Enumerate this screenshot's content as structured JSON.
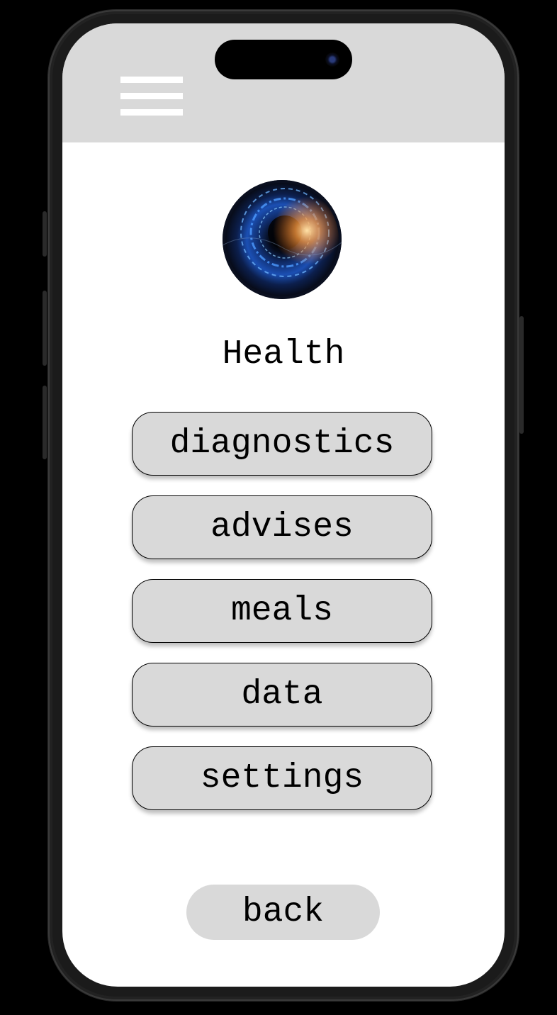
{
  "header": {
    "menu_icon": "hamburger-menu-icon"
  },
  "logo": {
    "icon": "eye-logo-image"
  },
  "page": {
    "title": "Health"
  },
  "menu": {
    "items": [
      {
        "label": "diagnostics"
      },
      {
        "label": "advises"
      },
      {
        "label": "meals"
      },
      {
        "label": "data"
      },
      {
        "label": "settings"
      }
    ]
  },
  "footer": {
    "back_label": "back"
  },
  "colors": {
    "header_bg": "#d9d9d9",
    "button_bg": "#d9d9d9",
    "screen_bg": "#ffffff"
  }
}
